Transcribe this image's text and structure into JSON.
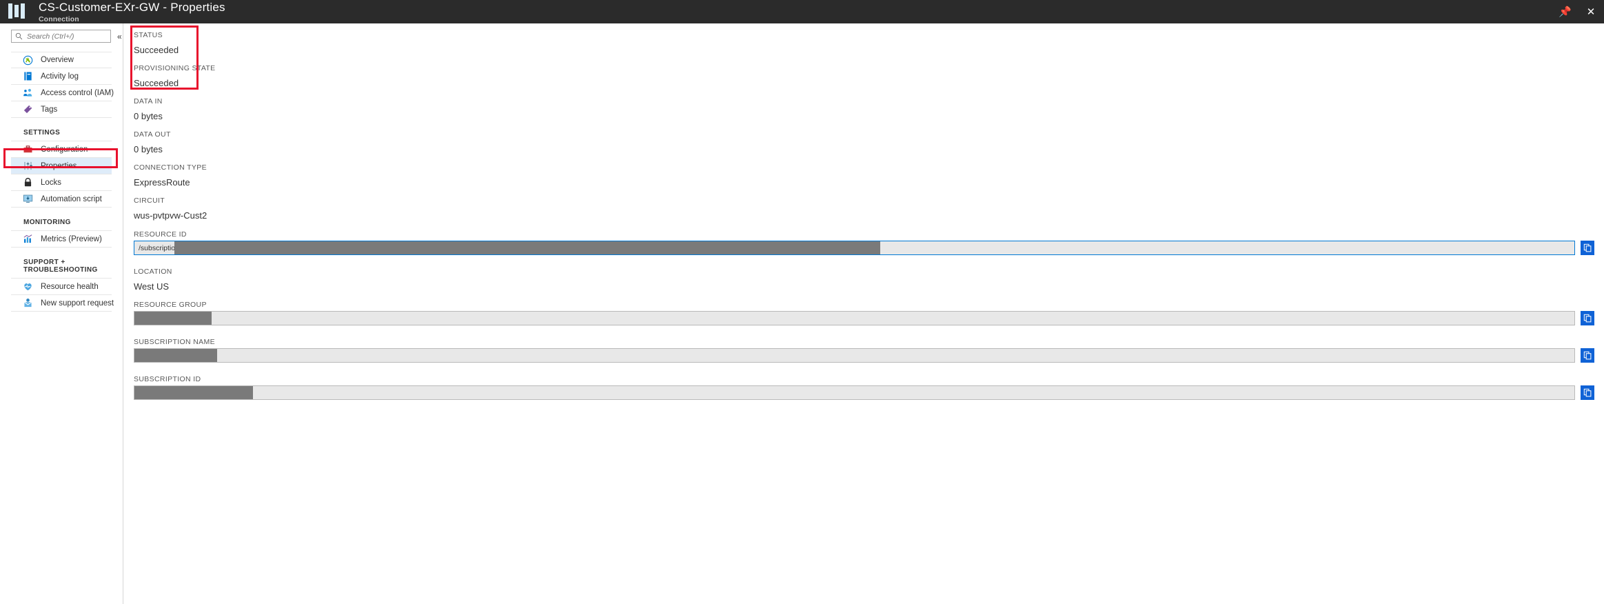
{
  "topbar": {
    "title": "CS-Customer-EXr-GW - Properties",
    "subtitle": "Connection",
    "pin_icon": "pin-icon",
    "close_icon": "close-icon",
    "logo_icon": "azure-resource-icon"
  },
  "sidebar": {
    "search": {
      "placeholder": "Search (Ctrl+/)",
      "value": "",
      "icon": "search-icon"
    },
    "collapse_label": "«",
    "items": [
      {
        "label": "Overview",
        "icon": "overview-icon",
        "selected": false
      },
      {
        "label": "Activity log",
        "icon": "activity-log-icon",
        "selected": false
      },
      {
        "label": "Access control (IAM)",
        "icon": "access-control-icon",
        "selected": false
      },
      {
        "label": "Tags",
        "icon": "tags-icon",
        "selected": false
      }
    ],
    "sections": [
      {
        "title": "SETTINGS",
        "items": [
          {
            "label": "Configuration",
            "icon": "configuration-icon",
            "selected": false
          },
          {
            "label": "Properties",
            "icon": "properties-icon",
            "selected": true
          },
          {
            "label": "Locks",
            "icon": "locks-icon",
            "selected": false
          },
          {
            "label": "Automation script",
            "icon": "automation-script-icon",
            "selected": false
          }
        ]
      },
      {
        "title": "MONITORING",
        "items": [
          {
            "label": "Metrics (Preview)",
            "icon": "metrics-icon",
            "selected": false
          }
        ]
      },
      {
        "title": "SUPPORT + TROUBLESHOOTING",
        "items": [
          {
            "label": "Resource health",
            "icon": "resource-health-icon",
            "selected": false
          },
          {
            "label": "New support request",
            "icon": "new-support-request-icon",
            "selected": false
          }
        ]
      }
    ]
  },
  "properties": {
    "status": {
      "label": "STATUS",
      "value": "Succeeded"
    },
    "provisioning_state": {
      "label": "PROVISIONING STATE",
      "value": "Succeeded"
    },
    "data_in": {
      "label": "DATA IN",
      "value": "0 bytes"
    },
    "data_out": {
      "label": "DATA OUT",
      "value": "0 bytes"
    },
    "connection_type": {
      "label": "CONNECTION TYPE",
      "value": "ExpressRoute"
    },
    "circuit": {
      "label": "CIRCUIT",
      "value": "wus-pvtpvw-Cust2"
    },
    "resource_id": {
      "label": "RESOURCE ID",
      "value": "/subscriptions",
      "redacted": true
    },
    "location": {
      "label": "LOCATION",
      "value": "West US"
    },
    "resource_group": {
      "label": "RESOURCE GROUP",
      "value": "",
      "redacted": true
    },
    "subscription_name": {
      "label": "SUBSCRIPTION NAME",
      "value": "",
      "redacted": true
    },
    "subscription_id": {
      "label": "SUBSCRIPTION ID",
      "value": "",
      "redacted": true
    },
    "copy_icon": "copy-icon"
  },
  "colors": {
    "topbar_bg": "#2b2b2b",
    "highlight_red": "#e8112d",
    "selected_nav": "#deecf9",
    "copy_button": "#0f62d6",
    "redaction": "#7a7a7a"
  }
}
